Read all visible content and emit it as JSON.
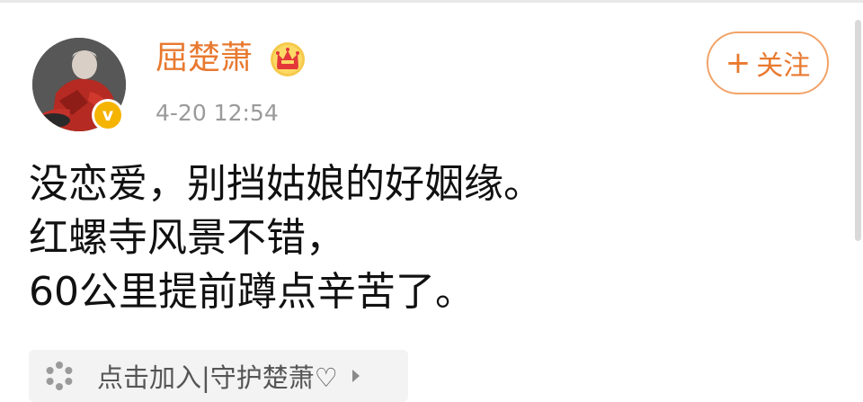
{
  "post": {
    "author": "屈楚萧",
    "timestamp": "4-20 12:54",
    "follow_label": "关注",
    "text_lines": [
      "没恋爱，别挡姑娘的好姻缘。",
      "红螺寺风景不错，",
      "60公里提前蹲点辛苦了。"
    ],
    "group_chip": "点击加入|守护楚萧♡"
  },
  "icons": {
    "avatar": "avatar-photo",
    "verified_badge": "verified-v-badge",
    "crown": "crown-icon",
    "follow": "plus-icon",
    "chip": "snowflake-icon",
    "chip_arrow": "chevron-right-icon"
  },
  "colors": {
    "accent": "#e8792f",
    "follow_border": "#f2a368",
    "verified": "#f5b400",
    "timestamp": "#9a9a9a",
    "text": "#111111",
    "chip_bg": "#f3f3f3"
  }
}
